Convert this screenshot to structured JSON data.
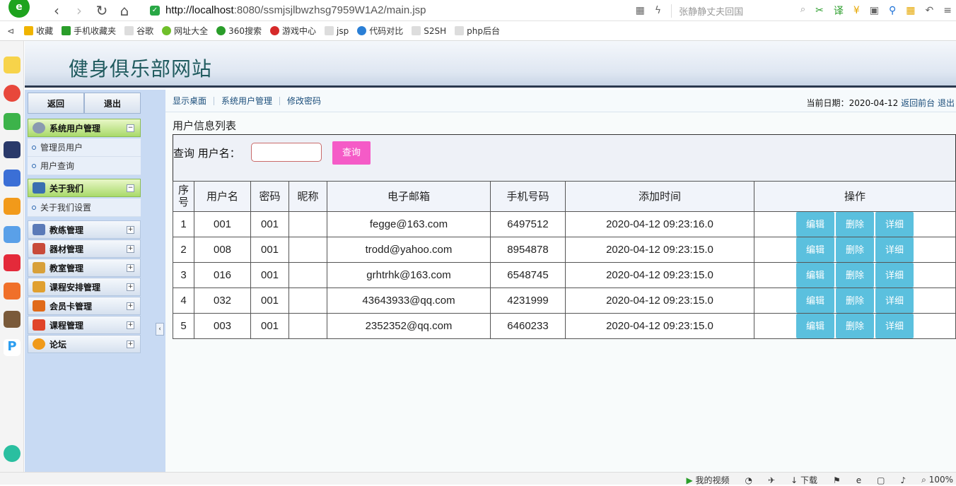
{
  "browser": {
    "url_host": "http://localhost",
    "url_path": ":8080/ssmjsjlbwzhsg7959W1A2/main.jsp",
    "search_placeholder": "张静静丈夫回国",
    "bookmarks": [
      "收藏",
      "手机收藏夹",
      "谷歌",
      "网址大全",
      "360搜索",
      "游戏中心",
      "jsp",
      "代码对比",
      "S2SH",
      "php后台"
    ]
  },
  "site": {
    "title": "健身俱乐部网站"
  },
  "leftnav": {
    "back_label": "返回",
    "logout_label": "退出",
    "groups": [
      {
        "label": "系统用户管理",
        "open": true,
        "items": [
          "管理员用户",
          "用户查询"
        ]
      },
      {
        "label": "关于我们",
        "open": true,
        "items": [
          "关于我们设置"
        ]
      },
      {
        "label": "教练管理",
        "open": false,
        "items": []
      },
      {
        "label": "器材管理",
        "open": false,
        "items": []
      },
      {
        "label": "教室管理",
        "open": false,
        "items": []
      },
      {
        "label": "课程安排管理",
        "open": false,
        "items": []
      },
      {
        "label": "会员卡管理",
        "open": false,
        "items": []
      },
      {
        "label": "课程管理",
        "open": false,
        "items": []
      },
      {
        "label": "论坛",
        "open": false,
        "items": []
      }
    ]
  },
  "crumbs": [
    "显示桌面",
    "系统用户管理",
    "修改密码"
  ],
  "datebar": {
    "prefix": "当前日期：",
    "date": "2020-04-12",
    "front_link": "返回前台",
    "exit_link": "退出"
  },
  "list": {
    "title": "用户信息列表",
    "search_label": "查询 用户名：",
    "search_value": "",
    "search_button": "查询",
    "columns": [
      "序号",
      "用户名",
      "密码",
      "昵称",
      "电子邮箱",
      "手机号码",
      "添加时间",
      "操作"
    ],
    "rows": [
      [
        "1",
        "001",
        "001",
        "",
        "fegge@163.com",
        "6497512",
        "2020-04-12 09:23:16.0"
      ],
      [
        "2",
        "008",
        "001",
        "",
        "trodd@yahoo.com",
        "8954878",
        "2020-04-12 09:23:15.0"
      ],
      [
        "3",
        "016",
        "001",
        "",
        "grhtrhk@163.com",
        "6548745",
        "2020-04-12 09:23:15.0"
      ],
      [
        "4",
        "032",
        "001",
        "",
        "43643933@qq.com",
        "4231999",
        "2020-04-12 09:23:15.0"
      ],
      [
        "5",
        "003",
        "001",
        "",
        "2352352@qq.com",
        "6460233",
        "2020-04-12 09:23:15.0"
      ]
    ],
    "actions": [
      "编辑",
      "删除",
      "详细"
    ]
  },
  "statusbar": {
    "video": "我的视频",
    "download": "下载",
    "zoom": "100%"
  },
  "colors": {
    "accent_pink": "#f55bc7",
    "op_blue": "#5bc0de",
    "title_green": "#1f5a5e"
  }
}
